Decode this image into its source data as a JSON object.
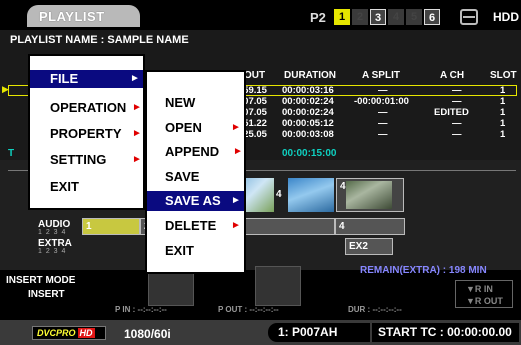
{
  "header": {
    "title": "PLAYLIST",
    "p2_label": "P2",
    "slots": [
      "1",
      "2",
      "3",
      "4",
      "5",
      "6"
    ],
    "hdd_label": "HDD"
  },
  "playlist": {
    "name_label": "PLAYLIST NAME : SAMPLE NAME",
    "columns": [
      "OUT",
      "DURATION",
      "A SPLIT",
      "A CH",
      "SLOT"
    ],
    "rows": [
      {
        "out": ":59.15",
        "duration": "00:00:03:16",
        "a_split": "—",
        "a_ch": "—",
        "slot": "1"
      },
      {
        "out": ":07.05",
        "duration": "00:00:02:24",
        "a_split": "-00:00:01:00",
        "a_ch": "—",
        "slot": "1"
      },
      {
        "out": ":07.05",
        "duration": "00:00:02:24",
        "a_split": "—",
        "a_ch": "EDITED",
        "slot": "1"
      },
      {
        "out": ":51.22",
        "duration": "00:00:05:12",
        "a_split": "—",
        "a_ch": "—",
        "slot": "1"
      },
      {
        "out": ":25.05",
        "duration": "00:00:03:08",
        "a_split": "—",
        "a_ch": "—",
        "slot": "1"
      }
    ],
    "total_prefix": "T",
    "total_duration": "00:00:15:00"
  },
  "timeline": {
    "audio_label": "AUDIO",
    "audio_channels": "1 2 3 4",
    "extra_label": "EXTRA",
    "extra_channels": "1 2 3 4",
    "clip_numbers": [
      "1",
      "2",
      "4",
      "4"
    ],
    "extra_clip": "EX2"
  },
  "info": {
    "remain": "REMAIN(EXTRA) : 198 MIN",
    "insert_mode_label": "INSERT MODE",
    "insert_mode_value": "INSERT",
    "p_in": "P IN : --:--:--:--",
    "p_out": "P OUT : --:--:--:--",
    "dur": "DUR : --:--:--:--",
    "r_in": "▼R IN",
    "r_out": "▼R OUT"
  },
  "status": {
    "codec": "DVCPRO",
    "codec_hd": "HD",
    "format": "1080/60i",
    "clip_id": "1: P007AH",
    "start_tc_label": "START TC",
    "start_tc_value": ": 00:00:00.00"
  },
  "menus": {
    "main": [
      {
        "label": "FILE",
        "has_sub": true,
        "selected": true
      },
      {
        "label": "OPERATION",
        "has_sub": true,
        "selected": false
      },
      {
        "label": "PROPERTY",
        "has_sub": true,
        "selected": false
      },
      {
        "label": "SETTING",
        "has_sub": true,
        "selected": false
      },
      {
        "label": "EXIT",
        "has_sub": false,
        "selected": false
      }
    ],
    "file": [
      {
        "label": "NEW",
        "has_sub": false,
        "selected": false
      },
      {
        "label": "OPEN",
        "has_sub": true,
        "selected": false
      },
      {
        "label": "APPEND",
        "has_sub": true,
        "selected": false
      },
      {
        "label": "SAVE",
        "has_sub": false,
        "selected": false
      },
      {
        "label": "SAVE AS",
        "has_sub": true,
        "selected": true
      },
      {
        "label": "DELETE",
        "has_sub": true,
        "selected": false
      },
      {
        "label": "EXIT",
        "has_sub": false,
        "selected": false
      }
    ]
  },
  "colors": {
    "selection": "#0a0a80",
    "submenu_arrow": "#e00000",
    "slot_active": "#e6e600",
    "total_text": "#0ed0c0",
    "remain_text": "#8787ff",
    "hd_badge": "#e01515"
  }
}
